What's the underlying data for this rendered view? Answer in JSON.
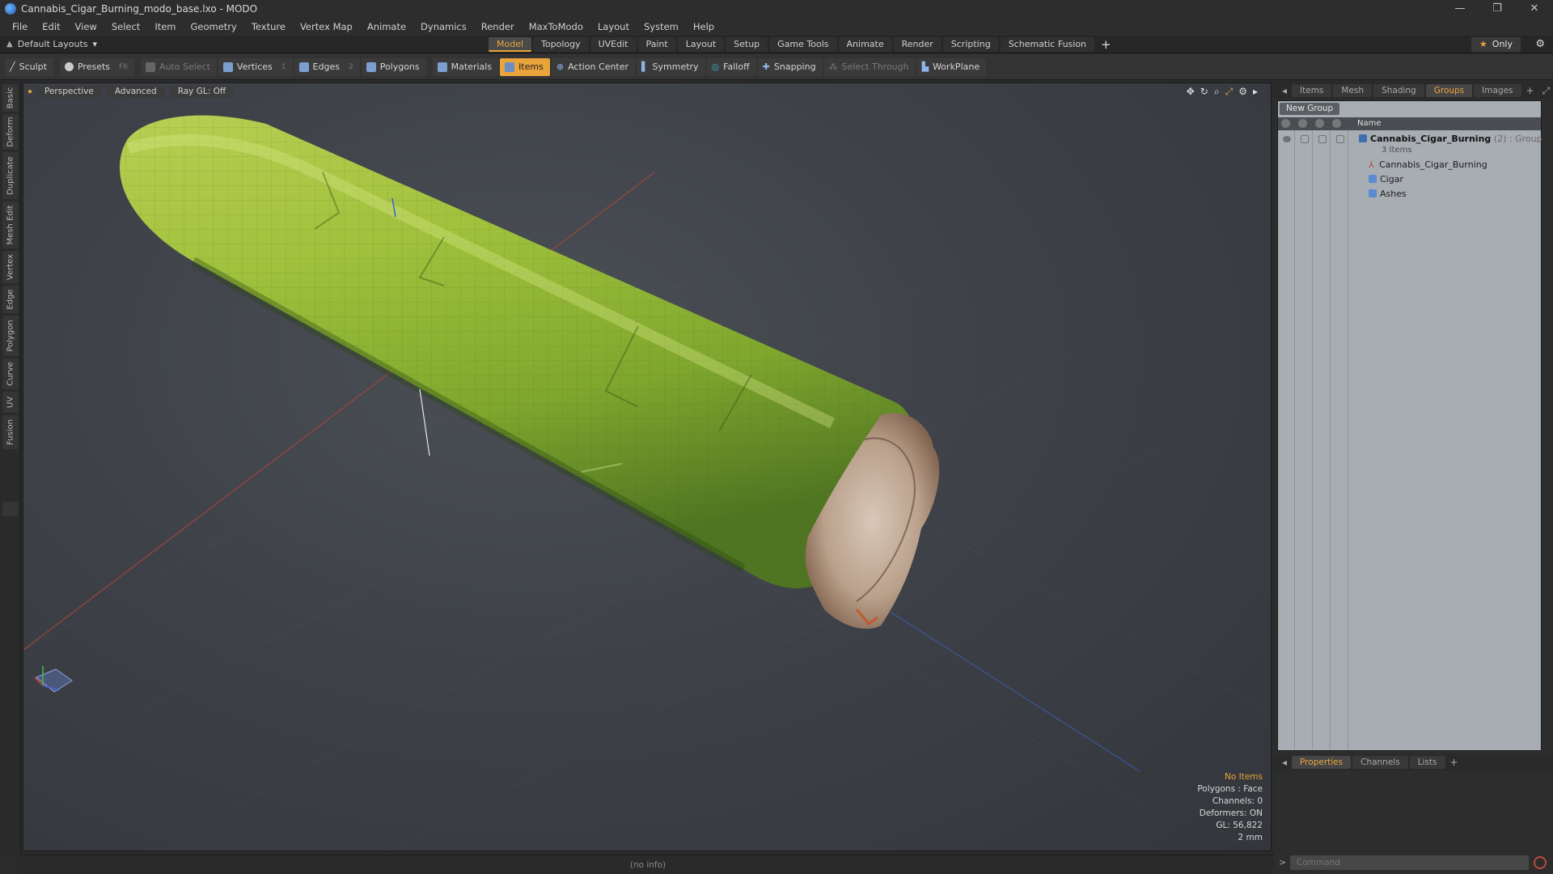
{
  "window": {
    "title": "Cannabis_Cigar_Burning_modo_base.lxo - MODO",
    "controls": [
      "—",
      "❐",
      "✕"
    ]
  },
  "menu": [
    "File",
    "Edit",
    "View",
    "Select",
    "Item",
    "Geometry",
    "Texture",
    "Vertex Map",
    "Animate",
    "Dynamics",
    "Render",
    "MaxToModo",
    "Layout",
    "System",
    "Help"
  ],
  "layout_selector": "Default Layouts",
  "layout_tabs": [
    {
      "label": "Model",
      "active": true
    },
    {
      "label": "Topology",
      "active": false
    },
    {
      "label": "UVEdit",
      "active": false
    },
    {
      "label": "Paint",
      "active": false
    },
    {
      "label": "Layout",
      "active": false
    },
    {
      "label": "Setup",
      "active": false
    },
    {
      "label": "Game Tools",
      "active": false
    },
    {
      "label": "Animate",
      "active": false
    },
    {
      "label": "Render",
      "active": false
    },
    {
      "label": "Scripting",
      "active": false
    },
    {
      "label": "Schematic Fusion",
      "active": false
    }
  ],
  "only_button": "Only",
  "toolbar": {
    "sculpt": "Sculpt",
    "presets": "Presets",
    "presets_key": "F6",
    "auto_select": "Auto Select",
    "vertices": "Vertices",
    "vertices_count": "1",
    "edges": "Edges",
    "edges_count": "2",
    "polygons": "Polygons",
    "materials": "Materials",
    "items": "Items",
    "action_center": "Action Center",
    "symmetry": "Symmetry",
    "falloff": "Falloff",
    "snapping": "Snapping",
    "select_through": "Select Through",
    "workplane": "WorkPlane"
  },
  "left_tabs": [
    "Basic",
    "Deform",
    "Duplicate",
    "Mesh Edit",
    "Vertex",
    "Edge",
    "Polygon",
    "Curve",
    "UV",
    "Fusion"
  ],
  "viewport": {
    "view_mode": "Perspective",
    "shading": "Advanced",
    "raygl": "Ray GL: Off",
    "info": {
      "no_items": "No Items",
      "polygons": "Polygons : Face",
      "channels": "Channels: 0",
      "deformers": "Deformers: ON",
      "gl": "GL: 56,822",
      "units": "2 mm"
    }
  },
  "status_bar": "(no info)",
  "right_panel": {
    "tabs": [
      {
        "label": "Items",
        "active": false
      },
      {
        "label": "Mesh ...",
        "active": false
      },
      {
        "label": "Shading",
        "active": false
      },
      {
        "label": "Groups",
        "active": true
      },
      {
        "label": "Images",
        "active": false
      }
    ],
    "new_group": "New Group",
    "column_name": "Name",
    "group": {
      "name": "Cannabis_Cigar_Burning",
      "count": "(2)",
      "type": ": Group",
      "items_label": "3 Items",
      "children": [
        "Cannabis_Cigar_Burning",
        "Cigar",
        "Ashes"
      ]
    },
    "bottom_tabs": [
      {
        "label": "Properties",
        "active": true
      },
      {
        "label": "Channels",
        "active": false
      },
      {
        "label": "Lists",
        "active": false
      }
    ],
    "command_placeholder": "Command"
  },
  "colors": {
    "accent": "#e9a43b",
    "panel_bg": "#2d2d2d",
    "list_bg": "#a8adb3"
  }
}
